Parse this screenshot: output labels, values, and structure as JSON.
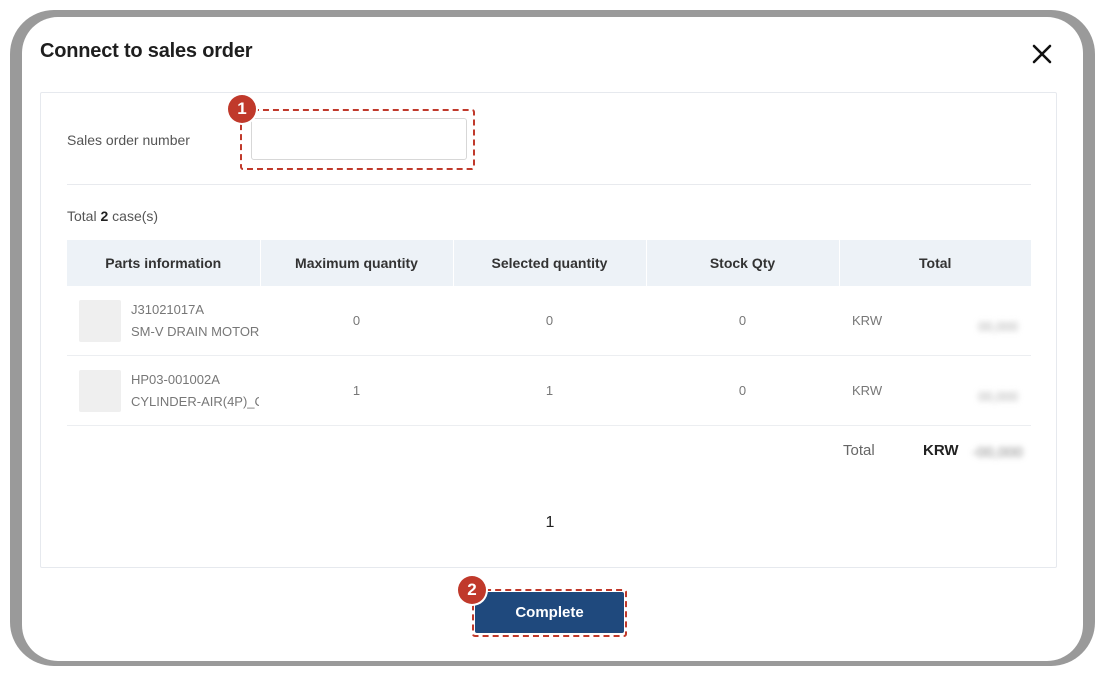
{
  "dialog": {
    "title": "Connect to sales order"
  },
  "form": {
    "sales_order_label": "Sales order number",
    "sales_order_value": "",
    "sales_order_placeholder": ""
  },
  "summary": {
    "total_prefix": "Total",
    "total_count": "2",
    "total_suffix": "case(s)"
  },
  "table": {
    "headers": [
      "Parts information",
      "Maximum quantity",
      "Selected quantity",
      "Stock Qty",
      "Total"
    ],
    "rows": [
      {
        "part_code": "J31021017A",
        "part_name": "SM-V DRAIN MOTOR",
        "max_qty": "0",
        "selected_qty": "0",
        "stock_qty": "0",
        "currency": "KRW",
        "amount": "00,000"
      },
      {
        "part_code": "HP03-001002A",
        "part_name": "CYLINDER-AIR(4P)_C",
        "max_qty": "1",
        "selected_qty": "1",
        "stock_qty": "0",
        "currency": "KRW",
        "amount": "00,000"
      }
    ]
  },
  "grand_total": {
    "label": "Total",
    "currency": "KRW",
    "amount": "-00,000"
  },
  "pagination": {
    "current_page": "1"
  },
  "actions": {
    "complete_label": "Complete"
  },
  "annotations": {
    "step_1": "1",
    "step_2": "2"
  },
  "colors": {
    "primary_button": "#1f497d",
    "annotation": "#c0392b",
    "header_bg": "#edf2f7"
  }
}
